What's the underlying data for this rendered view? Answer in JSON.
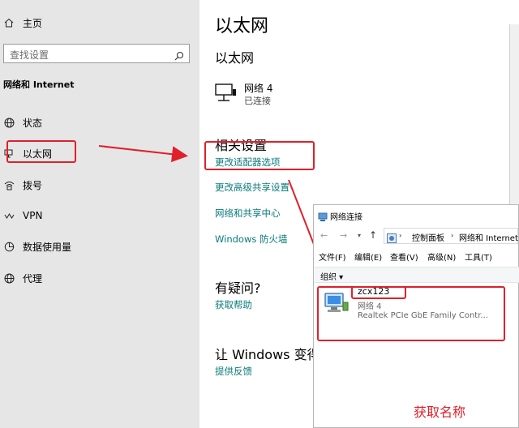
{
  "sidebar": {
    "home_label": "主页",
    "search_placeholder": "查找设置",
    "section_title": "网络和 Internet",
    "items": [
      {
        "label": "状态"
      },
      {
        "label": "以太网"
      },
      {
        "label": "拨号"
      },
      {
        "label": "VPN"
      },
      {
        "label": "数据使用量"
      },
      {
        "label": "代理"
      }
    ]
  },
  "main": {
    "page_title": "以太网",
    "section_title": "以太网",
    "connection": {
      "name": "网络 4",
      "status": "已连接"
    },
    "related": {
      "heading": "相关设置",
      "links": [
        "更改适配器选项",
        "更改高级共享设置",
        "网络和共享中心",
        "Windows 防火墙"
      ]
    },
    "help": {
      "heading": "有疑问?",
      "link": "获取帮助"
    },
    "improve": {
      "heading": "让 Windows 变得",
      "link": "提供反馈"
    }
  },
  "network_window": {
    "title": "网络连接",
    "breadcrumb": [
      "控制面板",
      "网络和 Internet"
    ],
    "menu": [
      "文件(F)",
      "编辑(E)",
      "查看(V)",
      "高级(N)",
      "工具(T)"
    ],
    "organize": "组织 ▾",
    "adapter": {
      "name": "zcx123",
      "network": "网络 4",
      "device": "Realtek PCIe GbE Family Contr..."
    }
  },
  "annotation": {
    "note": "获取名称"
  },
  "colors": {
    "sidebar_bg": "#e6e6e6",
    "link": "#0a7a7a",
    "annotation": "#e0202a"
  }
}
